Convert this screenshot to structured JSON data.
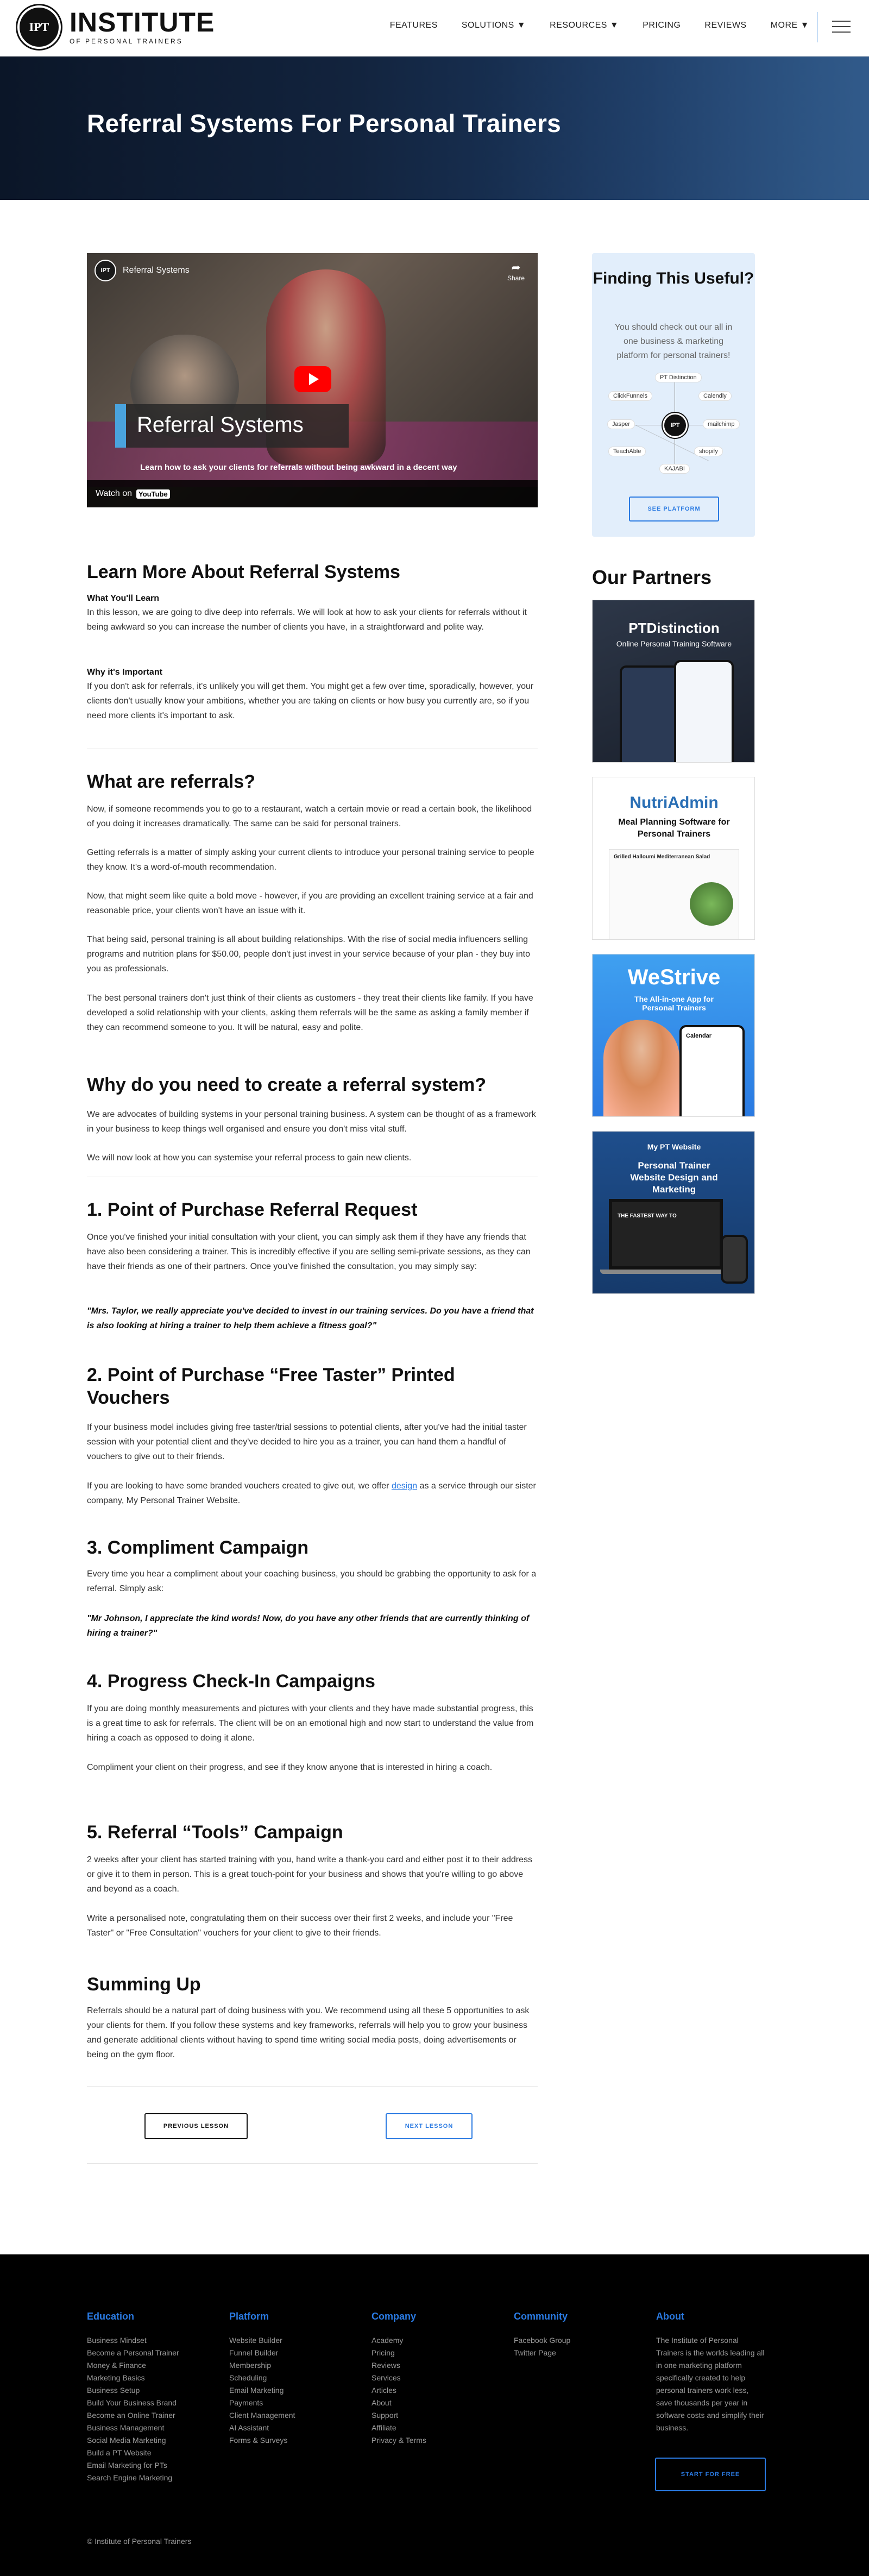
{
  "header": {
    "logo_badge": "IPT",
    "logo_main": "INSTITUTE",
    "logo_sub": "OF PERSONAL TRAINERS",
    "nav": [
      "FEATURES",
      "SOLUTIONS ▼",
      "RESOURCES ▼",
      "PRICING",
      "REVIEWS",
      "MORE ▼"
    ]
  },
  "hero": {
    "title": "Referral Systems For Personal Trainers"
  },
  "video": {
    "channel_badge": "IPT",
    "channel_title": "Referral Systems",
    "share": "Share",
    "title": "Referral Systems",
    "subtitle": "Learn how to ask your clients for referrals without being awkward in a decent way",
    "watch_on": "Watch on",
    "youtube": "YouTube"
  },
  "content": {
    "learn_heading": "Learn More About Referral Systems",
    "learn_label": "What You'll Learn",
    "learn_text": "In this lesson, we are going to dive deep into referrals. We will look at how to ask your clients for referrals without it being awkward so you can increase the number of clients you have, in a straightforward and polite way.",
    "why_label": "Why it's Important",
    "why_text": "If you don't ask for referrals, it's unlikely you will get them. You might get a few over time, sporadically, however, your clients don't usually know your ambitions, whether you are taking on clients or how busy you currently are, so if you need more clients it's important to ask.",
    "what_heading": "What are referrals?",
    "what_p1": "Now, if someone recommends you to go to a restaurant, watch a certain movie or read a certain book, the likelihood of you doing it increases dramatically. The same can be said for personal trainers.",
    "what_p2": "Getting referrals is a matter of simply asking your current clients to introduce your personal training service to people they know. It's a word-of-mouth recommendation.",
    "what_p3": "Now, that might seem like quite a bold move - however, if you are providing an excellent training service at a fair and reasonable price, your clients won't have an issue with it.",
    "what_p4": "That being said, personal training is all about building relationships. With the rise of social media influencers selling programs and nutrition plans for $50.00, people don't just invest in your service because of your plan - they buy into you as professionals.",
    "what_p5": "The best personal trainers don't just think of their clients as customers - they treat their clients like family. If you have developed a solid relationship with your clients, asking them referrals will be the same as asking a family member if they can recommend someone to you. It will be natural, easy and polite.",
    "why_need_heading": "Why do you need to create a referral system?",
    "why_need_p1": "We are advocates of building systems in your personal training business. A system can be thought of as a framework in your business to keep things well organised and ensure you don't miss vital stuff.",
    "why_need_p2": "We will now look at how you can systemise your referral process to gain new clients.",
    "s1_heading": "1. Point of Purchase Referral Request",
    "s1_p1": "Once you've finished your initial consultation with your client, you can simply ask them if they have any friends that have also been considering a trainer. This is incredibly effective if you are selling semi-private sessions, as they can have their friends as one of their partners. Once you've finished the consultation, you may simply say:",
    "s1_quote": "\"Mrs. Taylor, we really appreciate you've decided to invest in our training services. Do you have a friend that is also looking at hiring a trainer to help them achieve a fitness goal?\"",
    "s2_heading": "2. Point of Purchase “Free Taster” Printed Vouchers",
    "s2_p1": "If your business model includes giving free taster/trial sessions to potential clients, after you've had the initial taster session with your potential client and they've decided to hire you as a trainer, you can hand them a handful of vouchers to give out to their friends.",
    "s2_p2_a": "If you are looking to have some branded vouchers created to give out, we offer ",
    "s2_p2_link": "design",
    "s2_p2_b": " as a service through our sister company, My Personal Trainer Website.",
    "s3_heading": "3. Compliment Campaign",
    "s3_p1": "Every time you hear a compliment about your coaching business, you should be grabbing the opportunity to ask for a referral. Simply ask:",
    "s3_quote": "\"Mr Johnson, I appreciate the kind words! Now, do you have any other friends that are currently thinking of hiring a trainer?\"",
    "s4_heading": "4. Progress Check-In Campaigns",
    "s4_p1": "If you are doing monthly measurements and pictures with your clients and they have made substantial progress, this is a great time to ask for referrals. The client will be on an emotional high and now start to understand the value from hiring a coach as opposed to doing it alone.",
    "s4_p2": "Compliment your client on their progress, and see if they know anyone that is interested in hiring a coach.",
    "s5_heading": "5. Referral “Tools” Campaign",
    "s5_p1": "2 weeks after your client has started training with you, hand write a thank-you card and either post it to their address or give it to them in person. This is a great touch-point for your business and shows that you're willing to go above and beyond as a coach.",
    "s5_p2": "Write a personalised note, congratulating them on their success over their first 2 weeks, and include your \"Free Taster\" or \"Free Consultation\" vouchers for your client to give to their friends.",
    "sum_heading": "Summing Up",
    "sum_p1": "Referrals should be a natural part of doing business with you. We recommend using all these 5 opportunities to ask your clients for them. If you follow these systems and key frameworks, referrals will help you to grow your business and generate additional clients without having to spend time writing social media posts, doing advertisements or being on the gym floor.",
    "prev_button": "PREVIOUS LESSON",
    "next_button": "NEXT LESSON"
  },
  "sidebar": {
    "useful_title": "Finding This Useful?",
    "useful_text": "You should check out our all in one business & marketing platform for personal trainers!",
    "hub_center": "IPT",
    "hub_nodes": [
      "PT Distinction",
      "Calendly",
      "mailchimp",
      "shopify",
      "KAJABI",
      "ClickFunnels",
      "Jasper",
      "TeachAble"
    ],
    "platform_button": "SEE PLATFORM",
    "partners_title": "Our Partners",
    "ads": {
      "pt_title": "PTDistinction",
      "pt_sub": "Online Personal Training Software",
      "nutri_title": "NutriAdmin",
      "nutri_sub": "Meal Planning Software for Personal Trainers",
      "nutri_card": "Grilled Halloumi Mediterranean Salad",
      "strive_title": "WeStrive",
      "strive_sub": "The All-in-one App for Personal Trainers",
      "strive_calendar": "Calendar",
      "web_logo": "My PT Website",
      "web_title": "Personal Trainer Website Design and Marketing",
      "web_screen": "THE FASTEST WAY TO"
    }
  },
  "footer": {
    "columns": [
      {
        "title": "Education",
        "items": [
          "Business Mindset",
          "Become a Personal Trainer",
          "Money & Finance",
          "Marketing Basics",
          "Business Setup",
          "Build Your Business Brand",
          "Become an Online Trainer",
          "Business Management",
          "Social Media Marketing",
          "Build a PT Website",
          "Email Marketing for PTs",
          "Search Engine Marketing"
        ]
      },
      {
        "title": "Platform",
        "items": [
          "Website Builder",
          "Funnel Builder",
          "Membership",
          "Scheduling",
          "Email Marketing",
          "Payments",
          "Client Management",
          "AI Assistant",
          "Forms & Surveys"
        ]
      },
      {
        "title": "Company",
        "items": [
          "Academy",
          "Pricing",
          "Reviews",
          "Services",
          "Articles",
          "About",
          "Support",
          "Affiliate",
          "Privacy & Terms"
        ]
      },
      {
        "title": "Community",
        "items": [
          "Facebook Group",
          "Twitter Page"
        ]
      }
    ],
    "about_title": "About",
    "about_text": "The Institute of Personal Trainers is the worlds leading all in one marketing platform specifically created to help personal trainers work less, save thousands per year in software costs and simplify their business.",
    "free_button": "START FOR FREE",
    "copyright": "© Institute of Personal Trainers"
  }
}
